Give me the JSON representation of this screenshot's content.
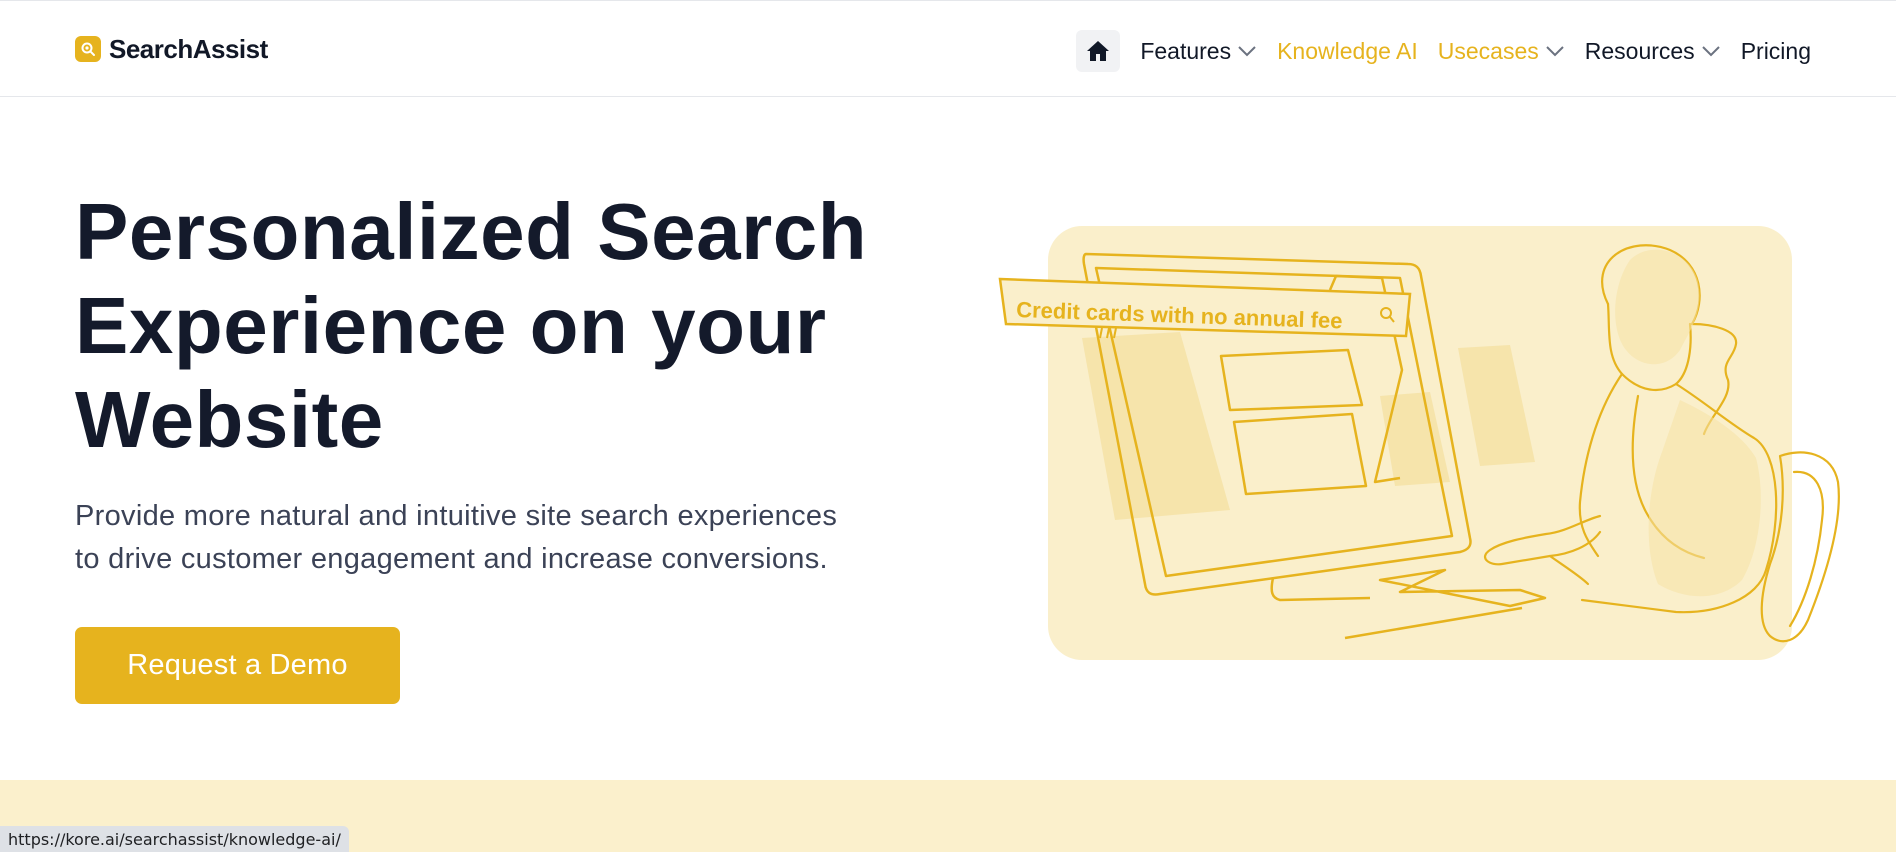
{
  "brand": {
    "name": "SearchAssist",
    "accent": "#e6b31e"
  },
  "nav": {
    "home_icon": "home-icon",
    "items": [
      {
        "label": "Features",
        "dropdown": true,
        "accent": false
      },
      {
        "label": "Knowledge AI",
        "dropdown": false,
        "accent": true
      },
      {
        "label": "Usecases",
        "dropdown": true,
        "accent": true
      },
      {
        "label": "Resources",
        "dropdown": true,
        "accent": false
      },
      {
        "label": "Pricing",
        "dropdown": false,
        "accent": false
      }
    ]
  },
  "hero": {
    "title_line1": "Personalized Search",
    "title_line2": "Experience on your",
    "title_line3": "Website",
    "subtitle_line1": "Provide more natural and intuitive site search experiences",
    "subtitle_line2": "to drive customer engagement and increase conversions.",
    "cta_label": "Request a Demo"
  },
  "illustration": {
    "search_query": "Credit cards with no annual fee",
    "search_icon": "search-icon"
  },
  "status_bar": {
    "url": "https://kore.ai/searchassist/knowledge-ai/"
  }
}
